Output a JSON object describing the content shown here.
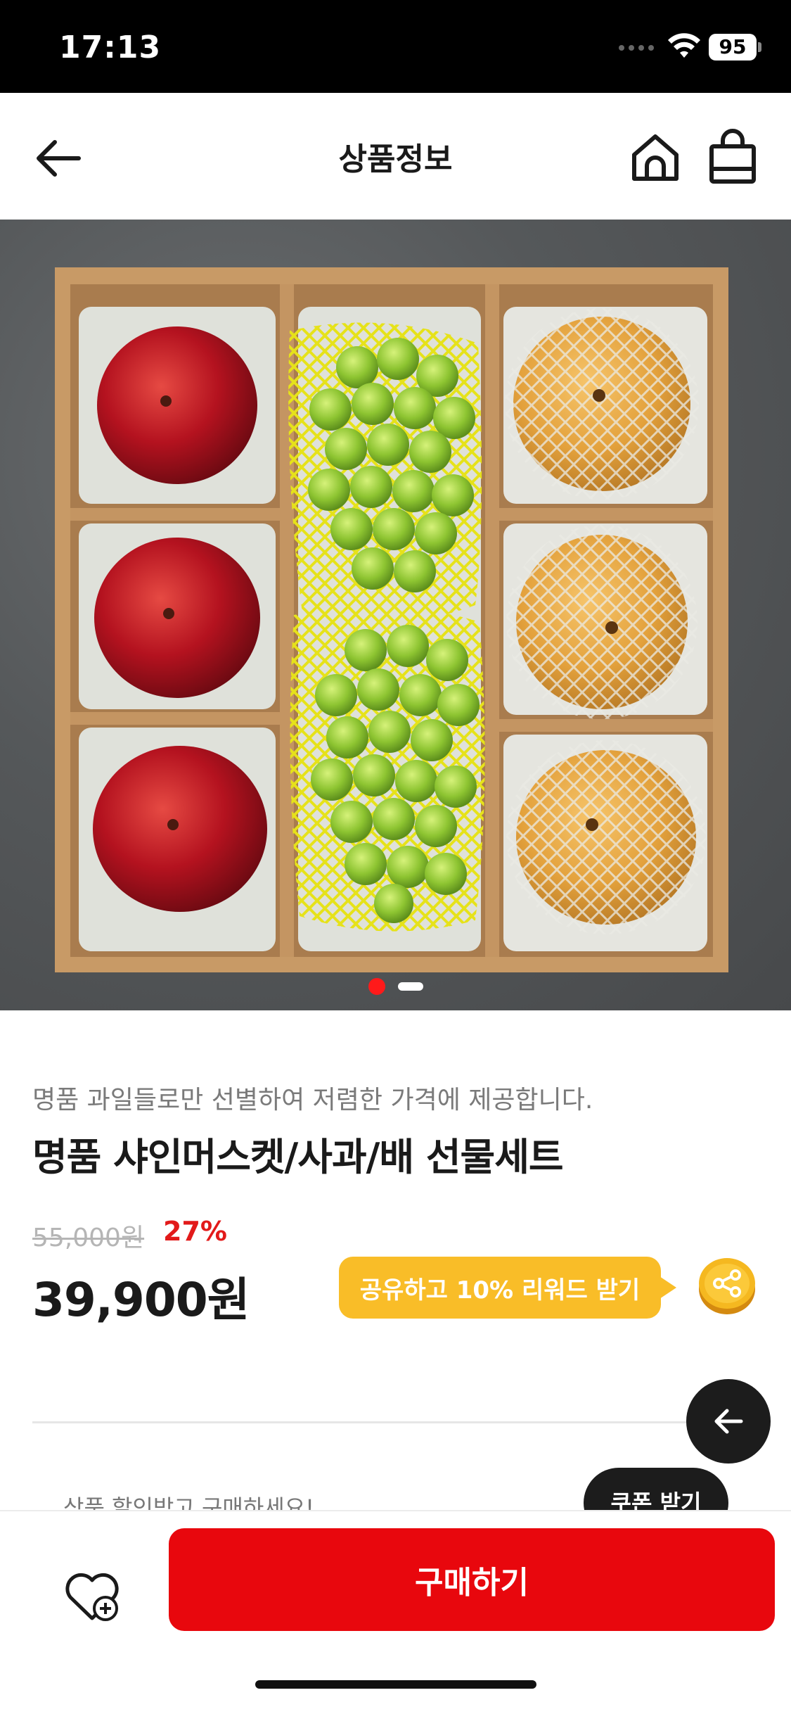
{
  "status_bar": {
    "time": "17:13",
    "battery": "95"
  },
  "nav": {
    "title": "상품정보"
  },
  "gallery": {
    "image_count": 2,
    "active_index": 0
  },
  "product": {
    "subtitle": "명품 과일들로만 선별하여 저렴한 가격에 제공합니다.",
    "name": "명품 샤인머스켓/사과/배 선물세트",
    "original_price": "55,000원",
    "discount": "27%",
    "sale_price": "39,900원"
  },
  "share": {
    "label": "공유하고 10% 리워드 받기"
  },
  "coupon": {
    "text": "상품 할인받고 구매하세요!",
    "button_label": "쿠폰 받기"
  },
  "bottom_bar": {
    "buy_label": "구매하기"
  },
  "colors": {
    "accent_red": "#e8070d",
    "discount_red": "#e21a1a",
    "share_yellow": "#f9bd28",
    "dark": "#1c1c1c"
  }
}
